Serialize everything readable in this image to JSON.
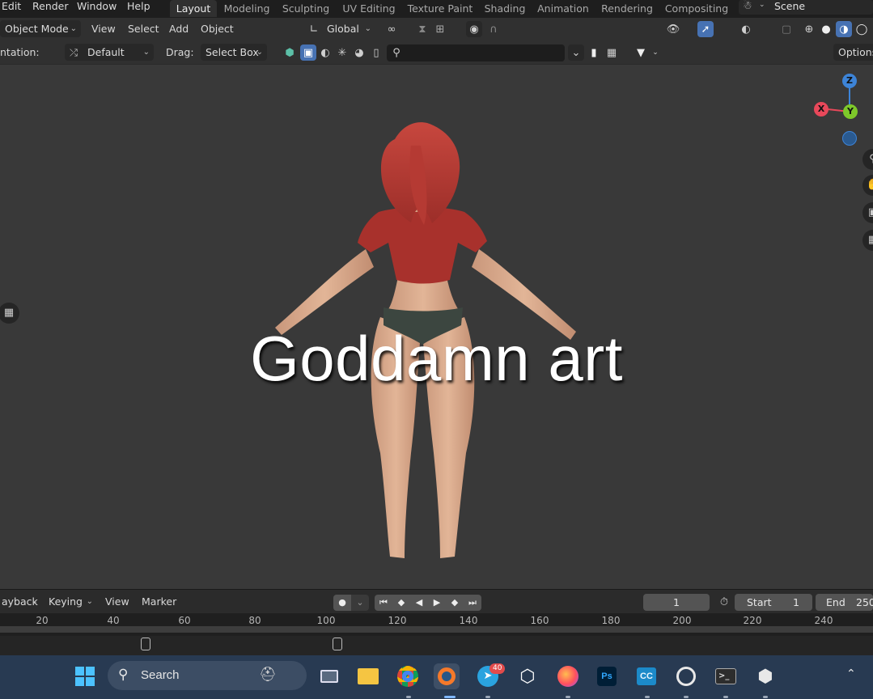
{
  "top_menu": {
    "items": [
      "Edit",
      "Render",
      "Window",
      "Help"
    ]
  },
  "workspaces": {
    "tabs": [
      "Layout",
      "Modeling",
      "Sculpting",
      "UV Editing",
      "Texture Paint",
      "Shading",
      "Animation",
      "Rendering",
      "Compositing"
    ],
    "active": "Layout"
  },
  "scene": {
    "label": "Scene"
  },
  "header": {
    "mode": "Object Mode",
    "menus": [
      "View",
      "Select",
      "Add",
      "Object"
    ],
    "transform_orientation": "Global",
    "tool_settings": {
      "orientation_label": "ntation:",
      "orientation_value": "Default",
      "drag_label": "Drag:",
      "drag_value": "Select Box"
    },
    "options_label": "Options"
  },
  "viewport": {
    "caption": "Goddamn art",
    "gizmo": {
      "z": "Z",
      "y": "Y",
      "x": "X"
    }
  },
  "timeline": {
    "menus": [
      "ayback",
      "Keying",
      "View",
      "Marker"
    ],
    "current_frame": "1",
    "start_label": "Start",
    "start_value": "1",
    "end_label": "End",
    "end_value": "250",
    "ticks": [
      "20",
      "40",
      "60",
      "80",
      "100",
      "120",
      "140",
      "160",
      "180",
      "200",
      "220",
      "240"
    ]
  },
  "taskbar": {
    "search_placeholder": "Search",
    "telegram_badge": "40",
    "apps": [
      "windows-start",
      "file-explorer",
      "chrome",
      "blender",
      "telegram",
      "unity",
      "firefox",
      "photoshop",
      "character-creator",
      "obs",
      "terminal",
      "unity-hub"
    ]
  },
  "colors": {
    "accent_blue": "#4772b3",
    "viewport_bg": "#393939",
    "axis_x": "#e8485a",
    "axis_y": "#7ec82a",
    "axis_z": "#3d84d8",
    "taskbar_bg": "#283a52"
  }
}
